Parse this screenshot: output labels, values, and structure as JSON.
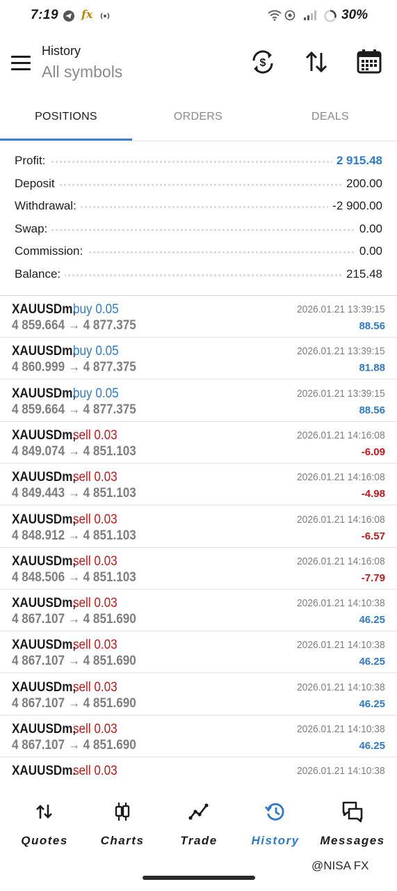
{
  "status_bar": {
    "time": "7:19",
    "fx_label": "fx",
    "battery": "30%"
  },
  "header": {
    "title": "History",
    "subtitle": "All symbols",
    "icons": [
      "menu-icon",
      "currency-exchange-icon",
      "sort-icon",
      "calendar-icon"
    ]
  },
  "tabs": [
    {
      "label": "POSITIONS",
      "active": true
    },
    {
      "label": "ORDERS",
      "active": false
    },
    {
      "label": "DEALS",
      "active": false
    }
  ],
  "summary": [
    {
      "label": "Profit:",
      "value": "2 915.48"
    },
    {
      "label": "Deposit",
      "value": "200.00"
    },
    {
      "label": "Withdrawal:",
      "value": "-2 900.00"
    },
    {
      "label": "Swap:",
      "value": "0.00"
    },
    {
      "label": "Commission:",
      "value": "0.00"
    },
    {
      "label": "Balance:",
      "value": "215.48"
    }
  ],
  "deals": [
    {
      "symbol": "XAUUSDm,",
      "side": "buy 0.05",
      "prices": "4 859.664 → 4 877.375",
      "time": "2026.01.21 13:39:15",
      "profit": "88.56"
    },
    {
      "symbol": "XAUUSDm,",
      "side": "buy 0.05",
      "prices": "4 860.999 → 4 877.375",
      "time": "2026.01.21 13:39:15",
      "profit": "81.88"
    },
    {
      "symbol": "XAUUSDm,",
      "side": "buy 0.05",
      "prices": "4 859.664 → 4 877.375",
      "time": "2026.01.21 13:39:15",
      "profit": "88.56"
    },
    {
      "symbol": "XAUUSDm,",
      "side": "sell 0.03",
      "prices": "4 849.074 → 4 851.103",
      "time": "2026.01.21 14:16:08",
      "profit": "-6.09"
    },
    {
      "symbol": "XAUUSDm,",
      "side": "sell 0.03",
      "prices": "4 849.443 → 4 851.103",
      "time": "2026.01.21 14:16:08",
      "profit": "-4.98"
    },
    {
      "symbol": "XAUUSDm,",
      "side": "sell 0.03",
      "prices": "4 848.912 → 4 851.103",
      "time": "2026.01.21 14:16:08",
      "profit": "-6.57"
    },
    {
      "symbol": "XAUUSDm,",
      "side": "sell 0.03",
      "prices": "4 848.506 → 4 851.103",
      "time": "2026.01.21 14:16:08",
      "profit": "-7.79"
    },
    {
      "symbol": "XAUUSDm,",
      "side": "sell 0.03",
      "prices": "4 867.107 → 4 851.690",
      "time": "2026.01.21 14:10:38",
      "profit": "46.25"
    },
    {
      "symbol": "XAUUSDm,",
      "side": "sell 0.03",
      "prices": "4 867.107 → 4 851.690",
      "time": "2026.01.21 14:10:38",
      "profit": "46.25"
    },
    {
      "symbol": "XAUUSDm,",
      "side": "sell 0.03",
      "prices": "4 867.107 → 4 851.690",
      "time": "2026.01.21 14:10:38",
      "profit": "46.25"
    },
    {
      "symbol": "XAUUSDm,",
      "side": "sell 0.03",
      "prices": "4 867.107 → 4 851.690",
      "time": "2026.01.21 14:10:38",
      "profit": "46.25"
    },
    {
      "symbol": "XAUUSDm.",
      "side": "sell 0.03",
      "prices": "",
      "time": "2026.01.21 14:10:38",
      "profit": ""
    }
  ],
  "bottom_nav": [
    {
      "label": "Quotes",
      "icon": "quotes-icon",
      "active": false
    },
    {
      "label": "Charts",
      "icon": "candlestick-chart-icon",
      "active": false
    },
    {
      "label": "Trade",
      "icon": "trade-line-icon",
      "active": false
    },
    {
      "label": "History",
      "icon": "history-icon",
      "active": true
    },
    {
      "label": "Messages",
      "icon": "messages-icon",
      "active": false
    }
  ],
  "watermark": "@NISA FX",
  "colors": {
    "accent": "#2f7ac7",
    "loss": "#c21818",
    "muted": "#7e7e7e",
    "active_nav_pill": "#e4eefb"
  }
}
